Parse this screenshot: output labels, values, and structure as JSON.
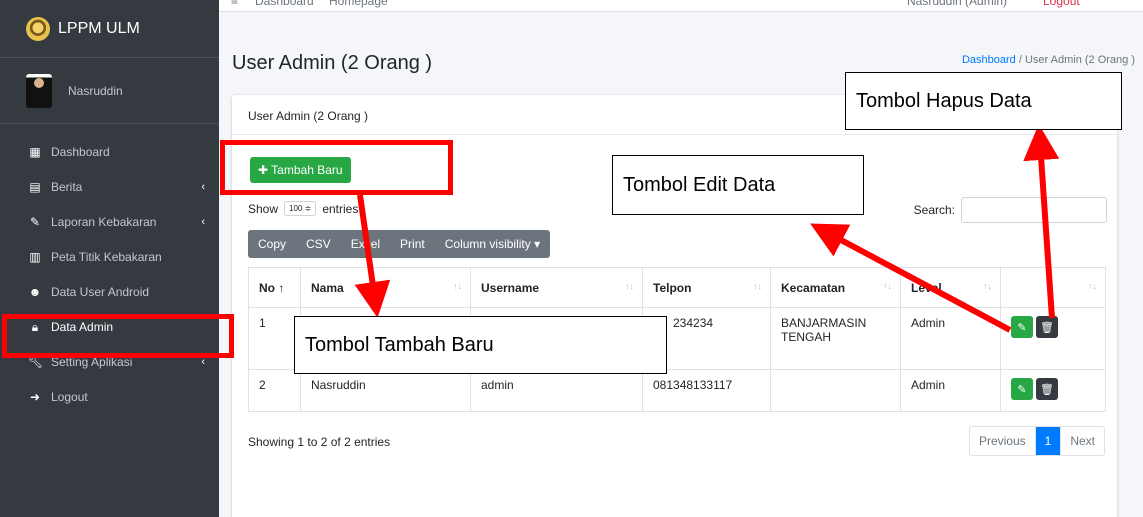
{
  "brand": {
    "title": "LPPM ULM"
  },
  "user": {
    "name": "Nasruddin"
  },
  "sidebar": {
    "items": [
      {
        "label": "Dashboard",
        "icon": "grid-icon"
      },
      {
        "label": "Berita",
        "icon": "newspaper-icon",
        "chevron": "‹"
      },
      {
        "label": "Laporan Kebakaran",
        "icon": "edit-icon",
        "chevron": "‹"
      },
      {
        "label": "Peta Titik Kebakaran",
        "icon": "map-icon"
      },
      {
        "label": "Data User Android",
        "icon": "users-icon"
      },
      {
        "label": "Data Admin",
        "icon": "lock-icon"
      },
      {
        "label": "Setting Aplikasi",
        "icon": "wrench-icon",
        "chevron": "‹"
      },
      {
        "label": "Logout",
        "icon": "logout-icon"
      }
    ]
  },
  "topbar": {
    "dashboard": "Dashboard",
    "homepage": "Homepage",
    "user": "Nasruddin (Admin)",
    "logout": "Logout"
  },
  "page": {
    "title": "User Admin (2 Orang )"
  },
  "breadcrumb": {
    "home": "Dashboard",
    "sep": "/",
    "current": "User Admin (2 Orang )"
  },
  "card": {
    "header": "User Admin (2 Orang )"
  },
  "toolbar": {
    "add_label": "Tambah Baru",
    "show_label": "Show",
    "show_value": "100 ≑",
    "entries_label": "entries",
    "search_label": "Search:",
    "buttons": [
      "Copy",
      "CSV",
      "Excel",
      "Print",
      "Column visibility ▾"
    ]
  },
  "table": {
    "headers": [
      "No ↑",
      "Nama",
      "Username",
      "Telpon",
      "Kecamatan",
      "Level",
      ""
    ],
    "rows": [
      {
        "no": "1",
        "nama": "",
        "username": "",
        "telpon": "234234",
        "kecamatan": "BANJARMASIN TENGAH",
        "level": "Admin"
      },
      {
        "no": "2",
        "nama": "Nasruddin",
        "username": "admin",
        "telpon": "081348133117",
        "kecamatan": "",
        "level": "Admin"
      }
    ]
  },
  "footer": {
    "info": "Showing 1 to 2 of 2 entries",
    "prev": "Previous",
    "page": "1",
    "next": "Next"
  },
  "annotations": {
    "hapus": "Tombol Hapus Data",
    "edit": "Tombol Edit Data",
    "tambah": "Tombol Tambah Baru"
  },
  "colors": {
    "sidebar": "#343a40",
    "success": "#28a745",
    "primary": "#007bff",
    "annotation": "#ff0000"
  }
}
